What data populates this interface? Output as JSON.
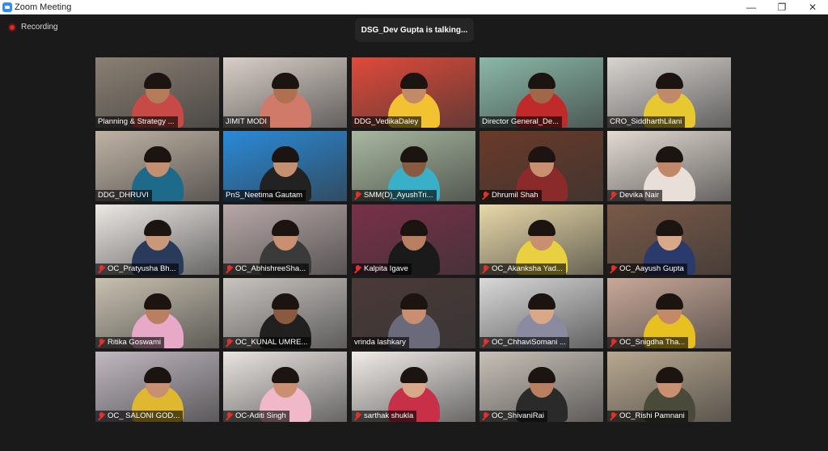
{
  "window": {
    "title": "Zoom Meeting",
    "controls": {
      "minimize": "—",
      "restore": "❐",
      "close": "✕"
    }
  },
  "recording": {
    "label": "Recording"
  },
  "banner": {
    "talking": "DSG_Dev Gupta is talking..."
  },
  "colors": {
    "background": "#1a1a1a",
    "muted_icon": "#e0312f",
    "active_speaker": "#c8c800"
  },
  "participants": [
    {
      "name": "Planning & Strategy ...",
      "muted": false,
      "bg": "#8a7f73",
      "shirt": "#c84a46",
      "skin": "#b57c5a"
    },
    {
      "name": "JIMIT MODI",
      "muted": false,
      "bg": "#d9cfc8",
      "shirt": "#d07a6a",
      "skin": "#b07050"
    },
    {
      "name": "DDG_VedikaDaley",
      "muted": false,
      "bg": "#e04a3a",
      "shirt": "#f2c232",
      "skin": "#c48a68"
    },
    {
      "name": "Director General_De...",
      "muted": false,
      "bg": "#8ab8a8",
      "shirt": "#c02a2a",
      "skin": "#a06848"
    },
    {
      "name": "CRO_SiddharthLilani",
      "muted": false,
      "bg": "#d8d4d0",
      "shirt": "#e8c830",
      "skin": "#c08a6a"
    },
    {
      "name": "DDG_DHRUVI",
      "muted": false,
      "bg": "#bfb2a4",
      "shirt": "#1e6a8a",
      "skin": "#c48f6e"
    },
    {
      "name": "PnS_Neetima Gautam",
      "muted": false,
      "bg": "#2a8ad8",
      "shirt": "#222222",
      "skin": "#c49070"
    },
    {
      "name": "SMM(D)_AyushTri...",
      "muted": true,
      "bg": "#a8b8a0",
      "shirt": "#3ab0c8",
      "skin": "#8a5a40"
    },
    {
      "name": "Dhrumil Shah",
      "muted": true,
      "bg": "#6a3a28",
      "shirt": "#8a2a2a",
      "skin": "#c89070"
    },
    {
      "name": "Devika Nair",
      "muted": true,
      "bg": "#e2dad2",
      "shirt": "#e8e0d8",
      "skin": "#c08868"
    },
    {
      "name": "OC_Pratyusha Bh...",
      "muted": true,
      "bg": "#ece8e4",
      "shirt": "#2a3a5a",
      "skin": "#c89878"
    },
    {
      "name": "OC_AbhishreeSha...",
      "muted": true,
      "bg": "#b8a8a8",
      "shirt": "#3a3a3a",
      "skin": "#c89070"
    },
    {
      "name": "Kalpita Igave",
      "muted": true,
      "bg": "#7a3048",
      "shirt": "#1a1a1a",
      "skin": "#b88060"
    },
    {
      "name": "OC_Akanksha Yad...",
      "muted": true,
      "bg": "#e8d8a8",
      "shirt": "#e8d040",
      "skin": "#c89070"
    },
    {
      "name": "OC_Aayush Gupta",
      "muted": true,
      "bg": "#7a5a48",
      "shirt": "#2a3a6a",
      "skin": "#d8a888"
    },
    {
      "name": "Ritika Goswami",
      "muted": true,
      "bg": "#c8c0b0",
      "shirt": "#e8a8c8",
      "skin": "#b88060"
    },
    {
      "name": "OC_KUNAL UMRE...",
      "muted": true,
      "bg": "#c8c4c0",
      "shirt": "#202020",
      "skin": "#8a5a40"
    },
    {
      "name": "vrinda lashkary",
      "muted": false,
      "bg": "#4a3a38",
      "shirt": "#6a6a7a",
      "skin": "#c89070"
    },
    {
      "name": "OC_ChhaviSomani ...",
      "muted": true,
      "bg": "#d8d8d8",
      "shirt": "#8a8aa0",
      "skin": "#d8a888"
    },
    {
      "name": "OC_Snigdha Tha...",
      "muted": true,
      "bg": "#c8a898",
      "shirt": "#e8c020",
      "skin": "#c48a68"
    },
    {
      "name": "OC_ SALONI GOD...",
      "muted": true,
      "bg": "#c0b8c0",
      "shirt": "#e0b830",
      "skin": "#c89070"
    },
    {
      "name": "OC-Aditi Singh",
      "muted": true,
      "bg": "#e8e4e0",
      "shirt": "#f0b8c8",
      "skin": "#c89070"
    },
    {
      "name": "sarthak shukla",
      "muted": true,
      "bg": "#f0ece8",
      "shirt": "#c83048",
      "skin": "#d8a888"
    },
    {
      "name": "OC_ShivaniRai",
      "muted": true,
      "bg": "#c8c0b8",
      "shirt": "#2a2a2a",
      "skin": "#b88060"
    },
    {
      "name": "OC_Rishi Pamnani",
      "muted": true,
      "bg": "#b8a890",
      "shirt": "#4a4a3a",
      "skin": "#c89070"
    }
  ]
}
